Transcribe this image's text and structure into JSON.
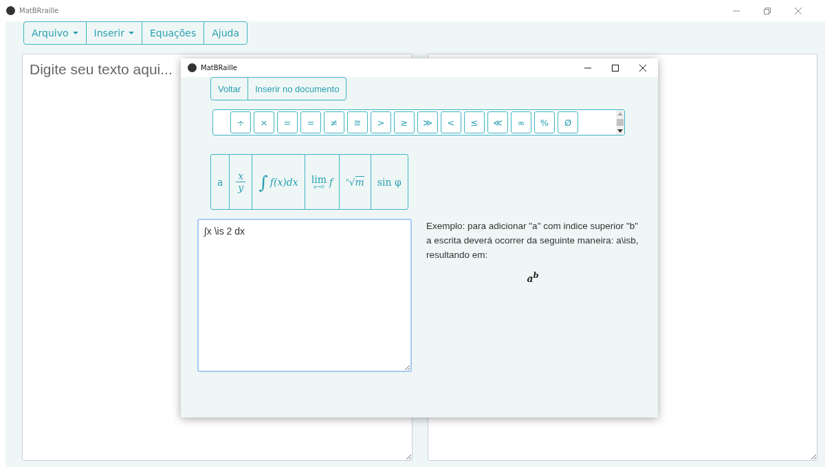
{
  "window": {
    "title": "MatBRraille"
  },
  "menu": [
    {
      "label": "Arquivo",
      "dropdown": true
    },
    {
      "label": "Inserir",
      "dropdown": true
    },
    {
      "label": "Equações",
      "dropdown": false
    },
    {
      "label": "Ajuda",
      "dropdown": false
    }
  ],
  "editor": {
    "placeholder": "Digite seu texto aqui..."
  },
  "dialog": {
    "title": "MatBRaille",
    "actions": [
      "Voltar",
      "Inserir no documento"
    ],
    "symbols": [
      "÷",
      "×",
      "=",
      "=",
      "≠",
      "≅",
      ">",
      "≥",
      "≫",
      "<",
      "≤",
      "≪",
      "∞",
      "%",
      "Ø"
    ],
    "formulas": [
      {
        "kind": "text",
        "text": "a"
      },
      {
        "kind": "fraction",
        "numerator": "x",
        "denominator": "y"
      },
      {
        "kind": "integral",
        "sign": "∫",
        "body": "f(x)dx"
      },
      {
        "kind": "limit",
        "op": "lim",
        "sub": "x→0",
        "body": "f"
      },
      {
        "kind": "root",
        "index": "n",
        "sign": "√",
        "radicand": "m"
      },
      {
        "kind": "text",
        "text": "sin φ"
      }
    ],
    "input": {
      "value": "∫x \\is 2 dx"
    },
    "example": {
      "text": "Exemplo: para adicionar \"a\" com indice superior \"b\" a escrita deverá ocorrer da seguinte maneira: a\\isb, resultando em:",
      "result": "a$^{b}$"
    }
  }
}
